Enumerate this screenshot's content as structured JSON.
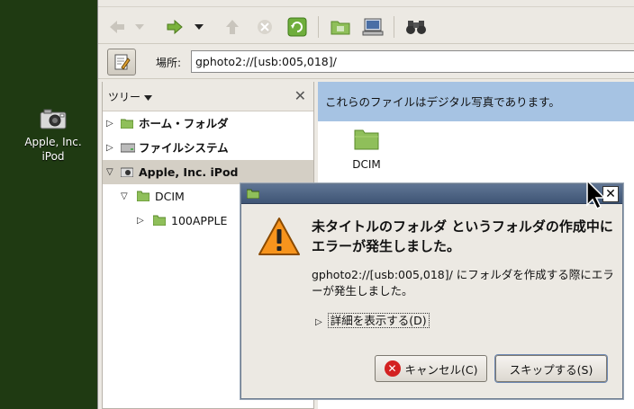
{
  "desktop": {
    "icon_label_line1": "Apple, Inc.",
    "icon_label_line2": "iPod"
  },
  "location": {
    "label": "場所:",
    "value": "gphoto2://[usb:005,018]/"
  },
  "sidebar": {
    "selector_label": "ツリー",
    "items": [
      {
        "label": "ホーム・フォルダ",
        "bold": true
      },
      {
        "label": "ファイルシステム",
        "bold": true
      },
      {
        "label": "Apple, Inc. iPod",
        "bold": true,
        "selected": true
      },
      {
        "label": "DCIM"
      },
      {
        "label": "100APPLE"
      }
    ]
  },
  "main": {
    "info_text": "これらのファイルはデジタル写真であります。",
    "files": [
      {
        "name": "DCIM"
      }
    ]
  },
  "dialog": {
    "primary_text": "未タイトルのフォルダ というフォルダの作成中にエラーが発生しました。",
    "secondary_text": "gphoto2://[usb:005,018]/ にフォルダを作成する際にエラーが発生しました。",
    "details_label": "詳細を表示する(D)",
    "cancel_label": "キャンセル(C)",
    "skip_label": "スキップする(S)"
  },
  "colors": {
    "infobar": "#a6c3e3",
    "desktop": "#1f3a12",
    "folder_green": "#8fbf5a"
  }
}
